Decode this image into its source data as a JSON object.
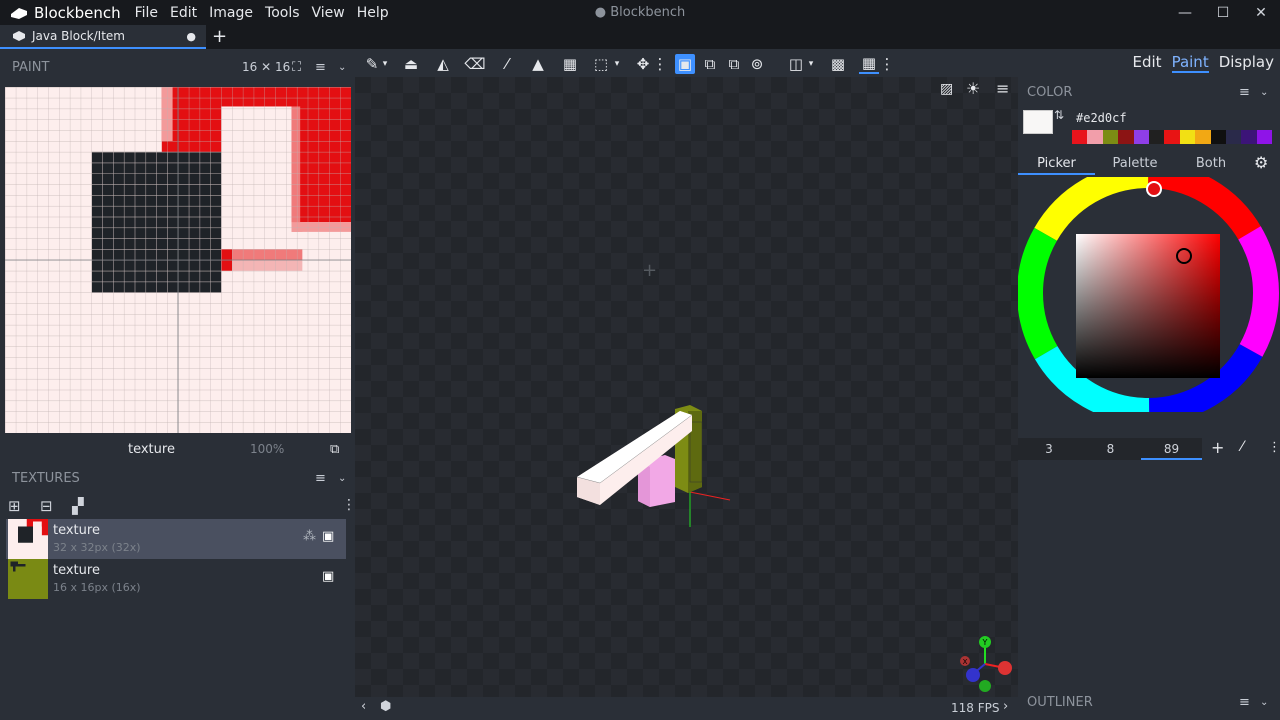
{
  "app": {
    "name": "Blockbench",
    "window_title": "Blockbench"
  },
  "menu": [
    "File",
    "Edit",
    "Image",
    "Tools",
    "View",
    "Help"
  ],
  "window_controls": {
    "minimize": "—",
    "maximize": "☐",
    "close": "✕"
  },
  "tabs": [
    {
      "label": "Java Block/Item",
      "unsaved_marker": "●"
    }
  ],
  "tab_add": "+",
  "modes": [
    "Edit",
    "Paint",
    "Display"
  ],
  "active_mode": "Paint",
  "paint_panel": {
    "title": "PAINT",
    "resolution": "16 ✕ 16",
    "texture_name": "texture",
    "zoom": "100%"
  },
  "textures_panel": {
    "title": "TEXTURES",
    "items": [
      {
        "name": "texture",
        "size": "32 x 32px (32x)",
        "selected": true
      },
      {
        "name": "texture",
        "size": "16 x 16px (16x)",
        "selected": false
      }
    ]
  },
  "color_panel": {
    "title": "COLOR",
    "hex": "#e2d0cf",
    "tabs": [
      "Picker",
      "Palette",
      "Both"
    ],
    "active_tab": "Picker",
    "values": [
      "3",
      "8",
      "89"
    ],
    "palette": [
      "#e8141c",
      "#f29eaa",
      "#7c8c14",
      "#8c1414",
      "#8f3ee8",
      "#202020",
      "#e81414",
      "#f2e014",
      "#f2a814",
      "#101010",
      "#2a2a4a",
      "#3c1478",
      "#8f14e8"
    ]
  },
  "outliner": {
    "title": "OUTLINER"
  },
  "viewport": {
    "fps": "118 FPS"
  }
}
